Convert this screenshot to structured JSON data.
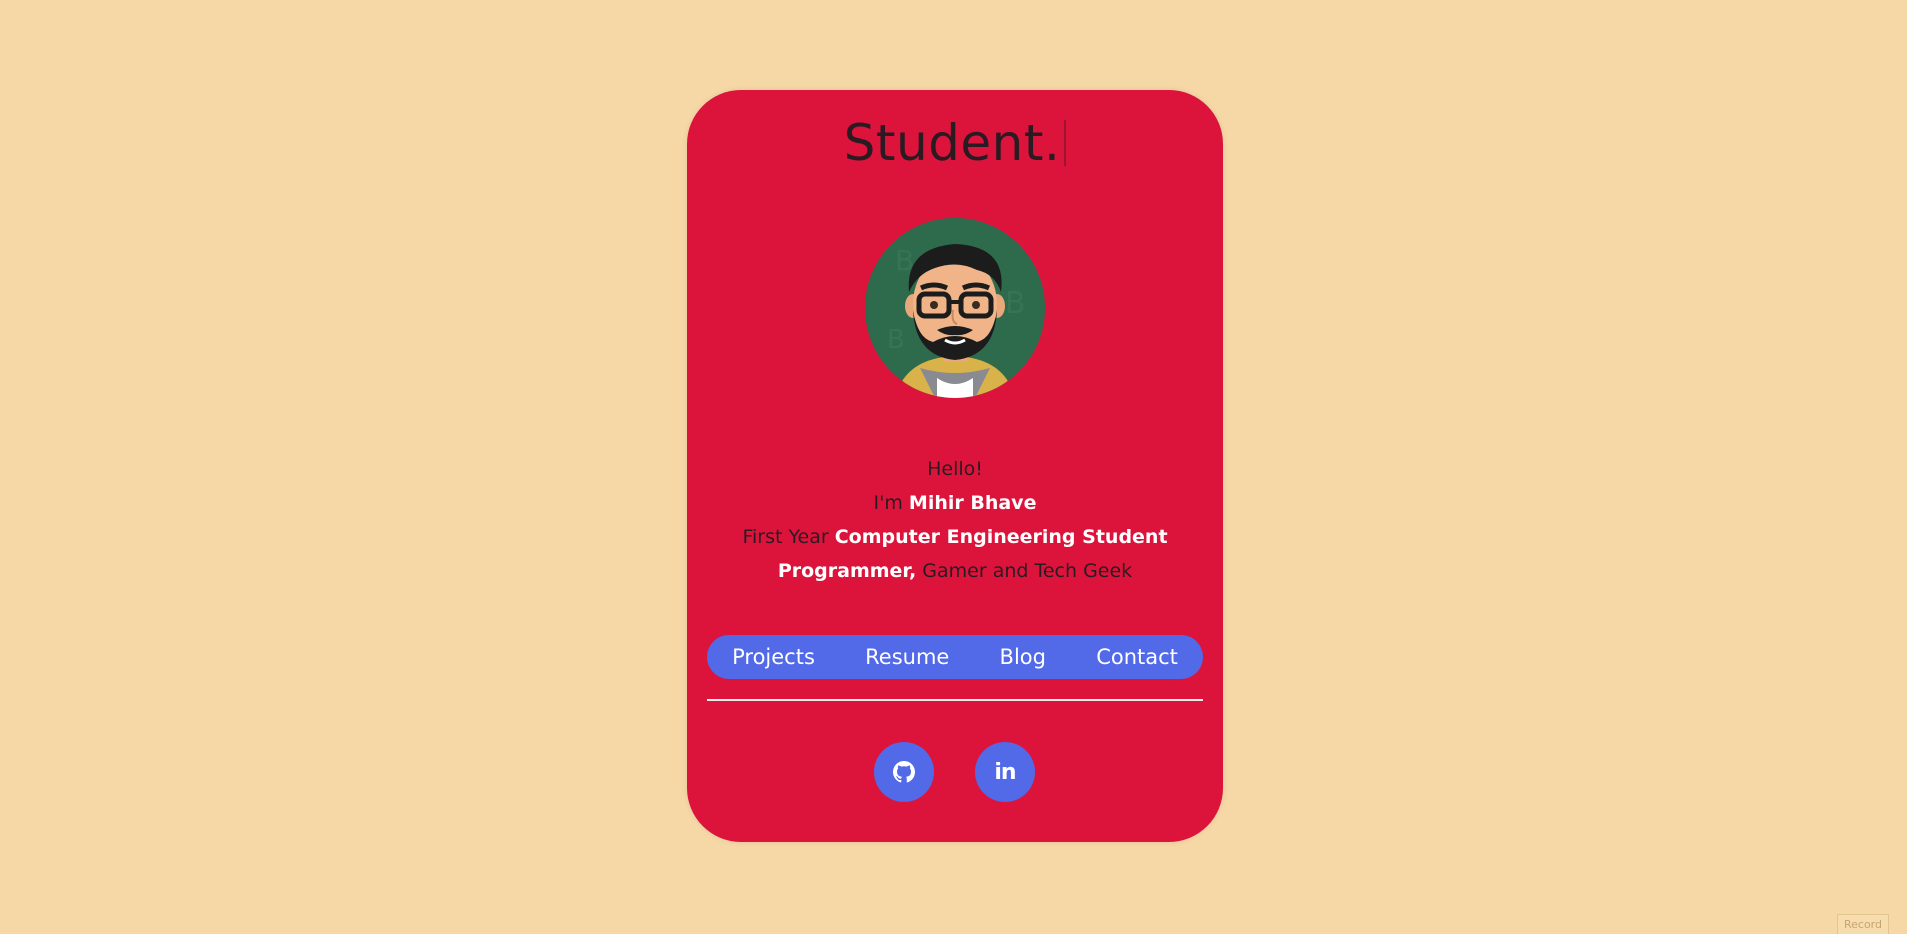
{
  "card": {
    "title": "Student.",
    "intro": {
      "hello": "Hello!",
      "im_prefix": "I'm ",
      "name": "Mihir Bhave",
      "year_prefix": "First Year ",
      "role": "Computer Engineering Student",
      "tagline_highlight": "Programmer,",
      "tagline_rest": " Gamer and Tech Geek"
    },
    "nav": [
      {
        "label": "Projects"
      },
      {
        "label": "Resume"
      },
      {
        "label": "Blog"
      },
      {
        "label": "Contact"
      }
    ],
    "social": [
      {
        "icon": "github-icon"
      },
      {
        "icon": "linkedin-icon",
        "glyph": "in"
      }
    ]
  },
  "record_label": "Record",
  "colors": {
    "background": "#f6d7a6",
    "card": "#dc143c",
    "accent": "#5269e8",
    "text_dark": "#2a1a22",
    "highlight": "#ffffff"
  }
}
